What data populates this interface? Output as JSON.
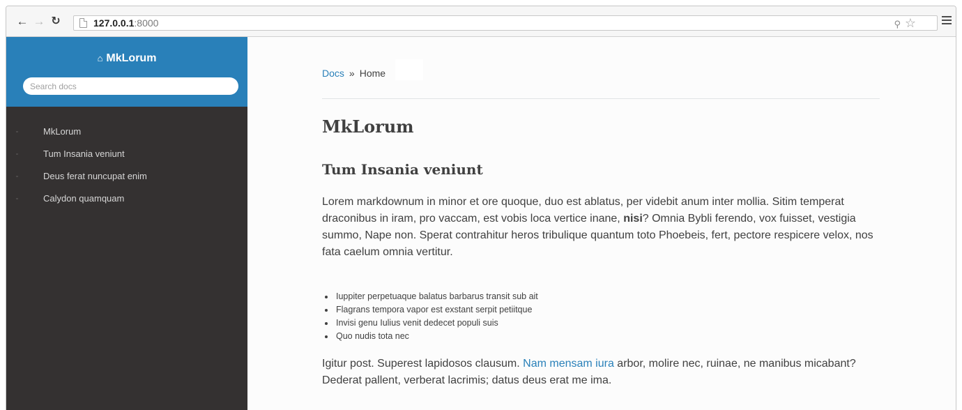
{
  "browser": {
    "url_host": "127.0.0.1",
    "url_port": ":8000",
    "icons": [
      "back-arrow-icon",
      "forward-arrow-icon",
      "reload-icon",
      "page-icon",
      "zoom-icon",
      "star-icon",
      "menu-icon"
    ]
  },
  "sidebar": {
    "brand": "MkLorum",
    "search_placeholder": "Search docs",
    "items": [
      {
        "label": "MkLorum"
      },
      {
        "label": "Tum Insania veniunt"
      },
      {
        "label": "Deus ferat nuncupat enim"
      },
      {
        "label": "Calydon quamquam"
      }
    ],
    "colors": {
      "header": "#2980b9",
      "background": "#343131"
    }
  },
  "breadcrumbs": {
    "root": "Docs",
    "separator": "»",
    "current": "Home"
  },
  "main": {
    "title": "MkLorum",
    "section_title": "Tum Insania veniunt",
    "paragraph1_before_bold": "Lorem markdownum in minor et ore quoque, duo est ablatus, per videbit anum inter mollia. Sitim temperat draconibus in iram, pro vaccam, est vobis loca vertice inane, ",
    "paragraph1_bold": "nisi",
    "paragraph1_after_bold": "? Omnia Bybli ferendo, vox fuisset, vestigia summo, Nape non. Sperat contrahitur heros tribulique quantum toto Phoebeis, fert, pectore respicere velox, nos fata caelum omnia vertitur.",
    "bullets": [
      "Iuppiter perpetuaque balatus barbarus transit sub ait",
      "Flagrans tempora vapor est exstant serpit petiitque",
      "Invisi genu Iulius venit dedecet populi suis",
      "Quo nudis tota nec"
    ],
    "paragraph2_before_link": "Igitur post. Superest lapidosos clausum. ",
    "paragraph2_link": "Nam mensam iura",
    "paragraph2_after_link": " arbor, molire nec, ruinae, ne manibus micabant? Dederat pallent, verberat lacrimis; datus deus erat me ima."
  },
  "colors": {
    "link": "#2980b9",
    "text": "#404040"
  }
}
